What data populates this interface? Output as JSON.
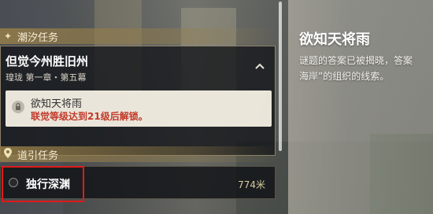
{
  "tide_section": {
    "icon": "sparkle-icon",
    "title": "潮汐任务"
  },
  "quest_card": {
    "title": "但觉今州胜旧州",
    "subtitle": "瑝珑 第一章・第五幕",
    "collapse_icon": "chevron-up-icon"
  },
  "locked_quest": {
    "title": "欲知天将雨",
    "requirement": "联觉等级达到21级后解锁。",
    "icon": "lock-icon"
  },
  "guide_section": {
    "icon": "location-pin-icon",
    "title": "道引任务"
  },
  "guide_quest": {
    "title": "独行深渊",
    "distance": "774米"
  },
  "detail": {
    "title": "欲知天将雨",
    "description": "谜题的答案已被揭晓，答案\n海岸”的组织的线索。"
  },
  "colors": {
    "highlight_box": "#e01a1a",
    "requirement_text": "#c23a2a",
    "section_header": "#967e48"
  }
}
